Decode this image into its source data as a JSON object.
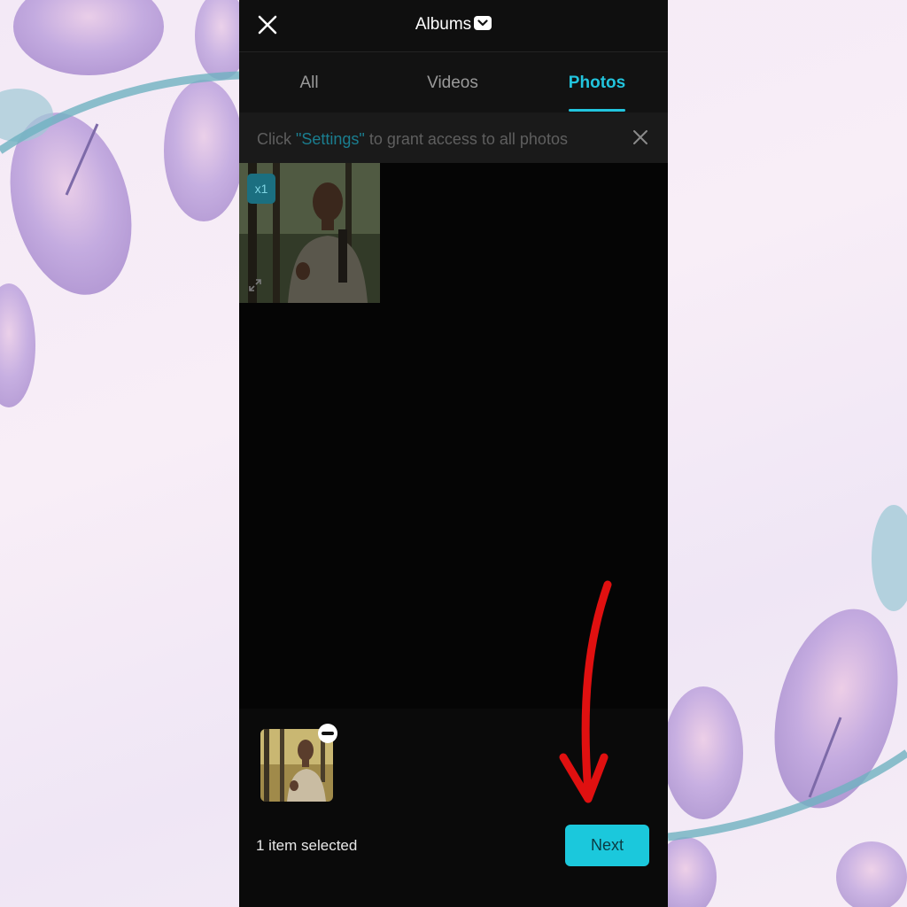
{
  "header": {
    "title": "Albums"
  },
  "tabs": [
    {
      "label": "All",
      "active": false
    },
    {
      "label": "Videos",
      "active": false
    },
    {
      "label": "Photos",
      "active": true
    }
  ],
  "banner": {
    "prefix": "Click ",
    "link": "\"Settings\"",
    "suffix": " to grant access to all photos"
  },
  "grid": {
    "items": [
      {
        "badge": "x1",
        "selected": true
      }
    ]
  },
  "selection": {
    "count_text": "1 item selected",
    "next_label": "Next"
  },
  "colors": {
    "accent": "#22c4dd",
    "next_button": "#1bc8dc",
    "annotation_arrow": "#e01010",
    "phone_background": "#121212"
  },
  "icons": [
    "close-icon",
    "album-dropdown-icon",
    "banner-close-icon",
    "expand-icon",
    "remove-selection-icon",
    "annotation-arrow"
  ]
}
